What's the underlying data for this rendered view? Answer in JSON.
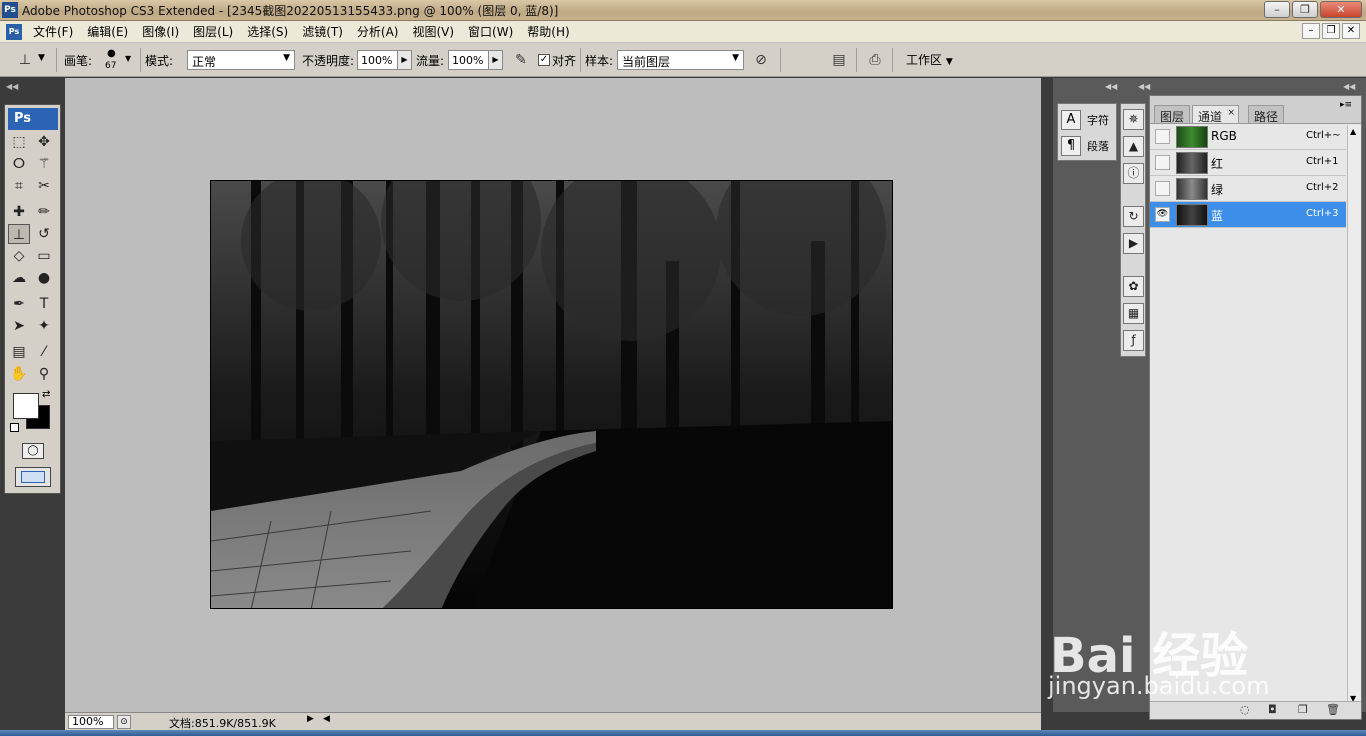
{
  "window": {
    "title": "Adobe Photoshop CS3 Extended - [2345截图20220513155433.png @ 100% (图层 0, 蓝/8)]",
    "app_icon": "Ps"
  },
  "menu": [
    "文件(F)",
    "编辑(E)",
    "图像(I)",
    "图层(L)",
    "选择(S)",
    "滤镜(T)",
    "分析(A)",
    "视图(V)",
    "窗口(W)",
    "帮助(H)"
  ],
  "options": {
    "brush_label": "画笔:",
    "brush_size": "67",
    "mode_label": "模式:",
    "mode_value": "正常",
    "opacity_label": "不透明度:",
    "opacity_value": "100%",
    "flow_label": "流量:",
    "flow_value": "100%",
    "aligned_label": "对齐",
    "aligned_checked": true,
    "sample_label": "样本:",
    "sample_value": "当前图层",
    "workspace_label": "工作区"
  },
  "toolbox": {
    "logo": "Ps"
  },
  "status": {
    "zoom": "100%",
    "doc_size": "文档:851.9K/851.9K"
  },
  "char_panel": {
    "character_label": "字符",
    "paragraph_label": "段落"
  },
  "channels_panel": {
    "tabs": [
      "图层",
      "通道",
      "路径"
    ],
    "active_tab": "通道",
    "channels": [
      {
        "name": "RGB",
        "shortcut": "Ctrl+~",
        "visible": false,
        "selected": false
      },
      {
        "name": "红",
        "shortcut": "Ctrl+1",
        "visible": false,
        "selected": false
      },
      {
        "name": "绿",
        "shortcut": "Ctrl+2",
        "visible": false,
        "selected": false
      },
      {
        "name": "蓝",
        "shortcut": "Ctrl+3",
        "visible": true,
        "selected": true
      }
    ]
  },
  "watermark": {
    "brand": "Bai 经验",
    "site": "jingyan.baidu.com"
  }
}
